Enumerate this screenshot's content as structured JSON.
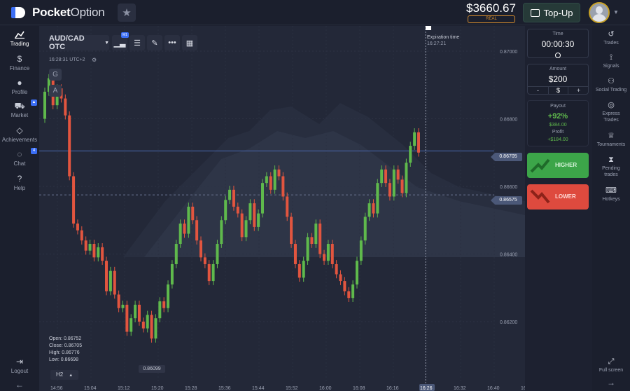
{
  "header": {
    "logo_bold": "Pocket",
    "logo_thin": "Option",
    "balance": "$3660.67",
    "account_type": "REAL",
    "topup_label": "Top-Up"
  },
  "left_nav": [
    {
      "label": "Trading",
      "icon": "chart-line-icon"
    },
    {
      "label": "Finance",
      "icon": "dollar-icon"
    },
    {
      "label": "Profile",
      "icon": "user-icon"
    },
    {
      "label": "Market",
      "icon": "cart-icon"
    },
    {
      "label": "Achievements",
      "icon": "diamond-icon"
    },
    {
      "label": "Chat",
      "icon": "chat-icon",
      "badge": "4"
    },
    {
      "label": "Help",
      "icon": "help-icon"
    },
    {
      "label": "Logout",
      "icon": "logout-icon"
    }
  ],
  "chart_toolbar": {
    "pair": "AUD/CAD OTC",
    "timeframe_badge": "M1",
    "timezone": "16:28:31 UTC+2",
    "tool_g": "G",
    "tool_a": "A",
    "ohlc": {
      "open": "Open: 0.86752",
      "close": "Close: 0.86705",
      "high": "High: 0.86776",
      "low": "Low: 0.86698"
    },
    "period_selector": "H2"
  },
  "expiration": {
    "label": "Expiration time",
    "time": "16:27:21"
  },
  "price_tags": {
    "current": "0.86705",
    "secondary": "0.86575",
    "low_marker": "0.86099"
  },
  "chart_data": {
    "type": "candlestick",
    "y_ticks": [
      "0.87000",
      "0.86800",
      "0.86600",
      "0.86400",
      "0.86200"
    ],
    "x_ticks": [
      "14:56",
      "15:04",
      "15:12",
      "15:20",
      "15:28",
      "15:36",
      "15:44",
      "15:52",
      "16:00",
      "16:08",
      "16:16",
      "16:26",
      "16:32",
      "16:40",
      "16:48"
    ],
    "highlight_x_tick": "16:26",
    "ylim": [
      0.861,
      0.8705
    ],
    "close_series": [
      0.8688,
      0.8692,
      0.8684,
      0.8689,
      0.8686,
      0.8681,
      0.8663,
      0.8649,
      0.8647,
      0.8644,
      0.8641,
      0.8643,
      0.8639,
      0.8642,
      0.8638,
      0.8629,
      0.8635,
      0.8628,
      0.8624,
      0.8625,
      0.8617,
      0.8621,
      0.8625,
      0.862,
      0.8618,
      0.8622,
      0.8615,
      0.8621,
      0.8626,
      0.8624,
      0.8631,
      0.8637,
      0.8643,
      0.8649,
      0.8646,
      0.8654,
      0.865,
      0.8644,
      0.8639,
      0.8637,
      0.8632,
      0.8637,
      0.8643,
      0.865,
      0.8656,
      0.8659,
      0.8654,
      0.8652,
      0.8645,
      0.865,
      0.8655,
      0.8648,
      0.8652,
      0.8661,
      0.8663,
      0.8659,
      0.8665,
      0.8663,
      0.8657,
      0.8651,
      0.8643,
      0.8637,
      0.8633,
      0.8638,
      0.8645,
      0.8643,
      0.8649,
      0.864,
      0.8638,
      0.8643,
      0.8637,
      0.8634,
      0.8632,
      0.8629,
      0.8627,
      0.8631,
      0.8638,
      0.8644,
      0.8651,
      0.8655,
      0.8652,
      0.8661,
      0.8665,
      0.8661,
      0.8657,
      0.8665,
      0.8662,
      0.8658,
      0.8667,
      0.8672,
      0.8676,
      0.867
    ]
  },
  "panel": {
    "time_label": "Time",
    "time_value": "00:00:30",
    "amount_label": "Amount",
    "amount_value": "$200",
    "minus": "-",
    "currency": "$",
    "plus": "+",
    "payout_label": "Payout",
    "payout_percent": "+92%",
    "payout_amount": "$384.00",
    "profit_label": "Profit",
    "profit_amount": "+$184.00",
    "higher_label": "HIGHER",
    "lower_label": "LOWER"
  },
  "right_nav": [
    {
      "label": "Trades",
      "icon": "history-icon"
    },
    {
      "label": "Signals",
      "icon": "antenna-icon"
    },
    {
      "label": "Social Trading",
      "icon": "people-icon"
    },
    {
      "label": "Express Trades",
      "icon": "target-icon"
    },
    {
      "label": "Tournaments",
      "icon": "trophy-icon"
    },
    {
      "label": "Pending trades",
      "icon": "hourglass-icon"
    },
    {
      "label": "Hotkeys",
      "icon": "keyboard-icon"
    },
    {
      "label": "Full screen",
      "icon": "fullscreen-icon"
    }
  ],
  "colors": {
    "up": "#5fb94c",
    "down": "#e2553f",
    "accent": "#3b6ef5"
  }
}
